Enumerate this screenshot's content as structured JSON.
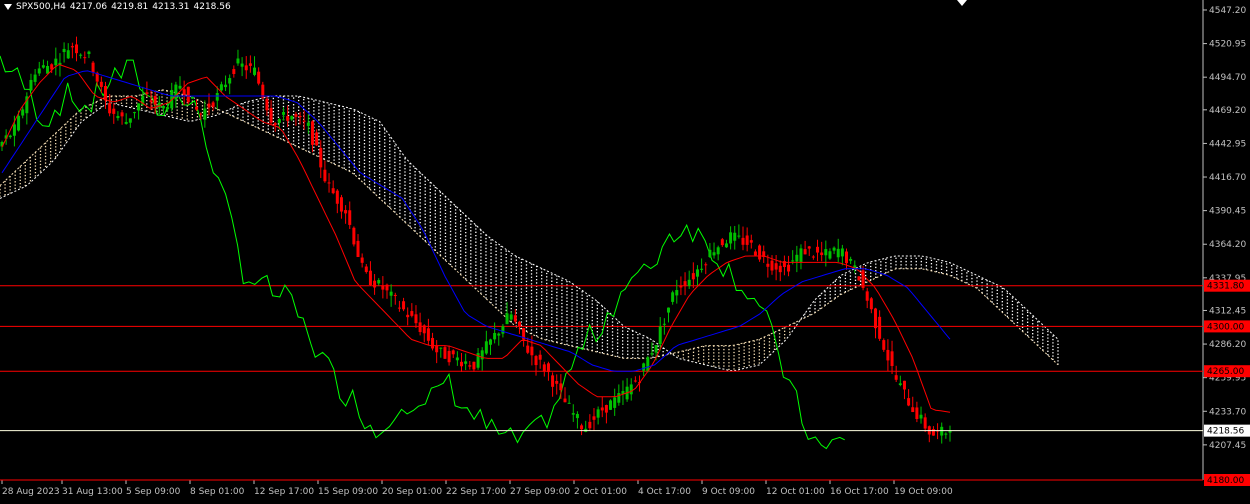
{
  "header": {
    "symbol": "SPX500,H4",
    "open": "4217.06",
    "high": "4219.81",
    "low": "4213.31",
    "close": "4218.56"
  },
  "colors": {
    "background": "#000000",
    "bull": "#00c000",
    "bear": "#ff0000",
    "tenkan": "#ff0000",
    "kijun": "#0000ff",
    "chikou": "#00ff00",
    "cloud_bull": "#f5deb3",
    "cloud_bear": "#ffffff",
    "level": "#ff0000",
    "price_line": "#ffffe0",
    "axis": "#c0c0c0"
  },
  "chart_data": {
    "type": "candlestick",
    "ylim": [
      4180,
      4555
    ],
    "y_ticks": [
      "4547.20",
      "4520.95",
      "4494.70",
      "4469.20",
      "4442.95",
      "4416.70",
      "4390.45",
      "4364.20",
      "4337.95",
      "4312.45",
      "4286.20",
      "4259.95",
      "4233.70",
      "4207.45"
    ],
    "x_ticks": [
      "28 Aug 2023",
      "31 Aug 13:00",
      "5 Sep 09:00",
      "8 Sep 01:00",
      "12 Sep 17:00",
      "15 Sep 09:00",
      "20 Sep 01:00",
      "22 Sep 17:00",
      "27 Sep 09:00",
      "2 Oct 01:00",
      "4 Oct 17:00",
      "9 Oct 09:00",
      "12 Oct 01:00",
      "16 Oct 17:00",
      "19 Oct 09:00"
    ],
    "levels": [
      {
        "value": 4331.8,
        "label": "4331.80"
      },
      {
        "value": 4300.0,
        "label": "4300.00"
      },
      {
        "value": 4265.0,
        "label": "4265.00"
      },
      {
        "value": 4180.0,
        "label": "4180.00"
      }
    ],
    "current_price": {
      "value": 4218.56,
      "label": "4218.56"
    },
    "ohlc_anchors": [
      4440,
      4455,
      4500,
      4505,
      4520,
      4510,
      4470,
      4460,
      4480,
      4470,
      4490,
      4465,
      4480,
      4505,
      4500,
      4460,
      4465,
      4455,
      4410,
      4390,
      4340,
      4330,
      4315,
      4300,
      4280,
      4275,
      4270,
      4290,
      4310,
      4280,
      4265,
      4240,
      4220,
      4235,
      4245,
      4260,
      4290,
      4330,
      4340,
      4360,
      4370,
      4365,
      4350,
      4345,
      4360,
      4355,
      4360,
      4340,
      4300,
      4260,
      4235,
      4215,
      4218.56
    ],
    "tenkan_anchors": [
      4440,
      4470,
      4490,
      4505,
      4500,
      4480,
      4475,
      4480,
      4470,
      4475,
      4490,
      4495,
      4480,
      4470,
      4460,
      4455,
      4430,
      4400,
      4370,
      4335,
      4320,
      4305,
      4290,
      4285,
      4285,
      4280,
      4275,
      4275,
      4290,
      4285,
      4270,
      4255,
      4245,
      4245,
      4250,
      4270,
      4300,
      4325,
      4340,
      4350,
      4355,
      4355,
      4350,
      4350,
      4350,
      4350,
      4345,
      4330,
      4305,
      4275,
      4235,
      4233
    ],
    "kijun_anchors": [
      4420,
      4445,
      4470,
      4495,
      4500,
      4495,
      4490,
      4485,
      4480,
      4480,
      4480,
      4480,
      4480,
      4480,
      4475,
      4460,
      4440,
      4420,
      4410,
      4400,
      4375,
      4340,
      4310,
      4300,
      4295,
      4290,
      4285,
      4280,
      4270,
      4265,
      4265,
      4270,
      4285,
      4290,
      4295,
      4300,
      4310,
      4325,
      4335,
      4340,
      4345,
      4345,
      4340,
      4330,
      4310,
      4290
    ],
    "chikou_anchors": [
      4510,
      4490,
      4460,
      4480,
      4470,
      4495,
      4500,
      4470,
      4480,
      4465,
      4400,
      4340,
      4330,
      4320,
      4290,
      4260,
      4240,
      4215,
      4245,
      4230,
      4260,
      4235,
      4220,
      4210,
      4215,
      4240,
      4280,
      4300,
      4330,
      4340,
      4370,
      4380,
      4360,
      4340,
      4320,
      4280,
      4230,
      4200,
      4215
    ],
    "cloud_a_anchors": [
      4410,
      4430,
      4450,
      4470,
      4480,
      4480,
      4485,
      4480,
      4470,
      4460,
      4450,
      4440,
      4430,
      4420,
      4400,
      4380,
      4360,
      4340,
      4320,
      4300,
      4290,
      4285,
      4280,
      4275,
      4275,
      4280,
      4285,
      4285,
      4290,
      4300,
      4310,
      4325,
      4335,
      4345,
      4345,
      4340,
      4330,
      4310,
      4290,
      4270
    ],
    "cloud_b_anchors": [
      4400,
      4410,
      4430,
      4460,
      4475,
      4470,
      4465,
      4460,
      4465,
      4475,
      4480,
      4480,
      4475,
      4470,
      4460,
      4430,
      4410,
      4390,
      4370,
      4355,
      4345,
      4335,
      4320,
      4300,
      4290,
      4275,
      4270,
      4265,
      4270,
      4290,
      4320,
      4340,
      4350,
      4355,
      4355,
      4350,
      4340,
      4330,
      4310,
      4290
    ]
  }
}
